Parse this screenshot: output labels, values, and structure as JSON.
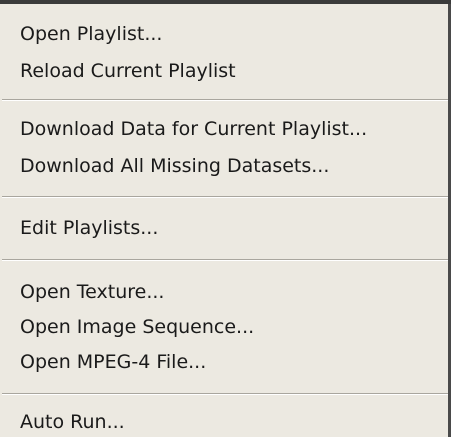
{
  "menu": {
    "items": [
      {
        "label": "Open Playlist..."
      },
      {
        "label": "Reload Current Playlist"
      },
      {
        "label": "Download Data for Current Playlist..."
      },
      {
        "label": "Download All Missing Datasets..."
      },
      {
        "label": "Edit Playlists..."
      },
      {
        "label": "Open Texture..."
      },
      {
        "label": "Open Image Sequence..."
      },
      {
        "label": "Open MPEG-4 File..."
      },
      {
        "label": "Auto Run..."
      }
    ]
  }
}
